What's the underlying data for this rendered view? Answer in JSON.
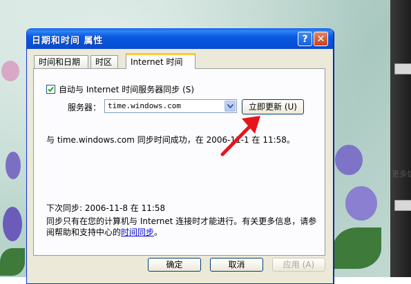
{
  "dialog": {
    "title": "日期和时间 属性",
    "help_button": "?",
    "close_button": "✕"
  },
  "tabs": [
    {
      "label": "时间和日期",
      "active": false
    },
    {
      "label": "时区",
      "active": false
    },
    {
      "label": "Internet 时间",
      "active": true
    }
  ],
  "internet_time": {
    "auto_sync_label": "自动与 Internet 时间服务器同步 (S)",
    "auto_sync_checked": true,
    "server_label": "服务器：",
    "server_value": "time.windows.com",
    "update_button": "立即更新 (U)",
    "status_text": "与 time.windows.com 同步时间成功，在 2006-11-1 在 11:58。",
    "next_sync_text": "下次同步: 2006-11-8 在 11:58",
    "info_text": "同步只有在您的计算机与 Internet 连接时才能进行。有关更多信息，请参阅帮助和支持中心的",
    "info_link": "时间同步",
    "info_suffix": "。"
  },
  "footer": {
    "ok": "确定",
    "cancel": "取消",
    "apply": "应用 (A)"
  },
  "background_fragment": "更多信",
  "colors": {
    "titlebar": "#0a5ce8",
    "annotation_arrow": "#e8141b",
    "active_tab_highlight": "#ffc83c"
  }
}
